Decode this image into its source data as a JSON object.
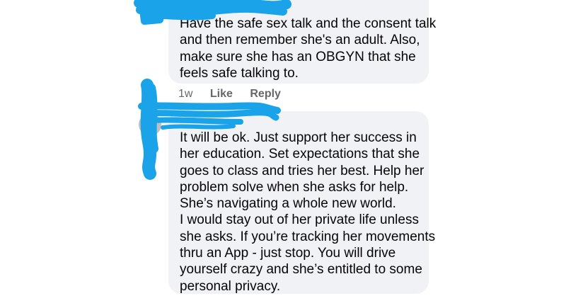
{
  "comments": [
    {
      "author": "...",
      "lines": [
        "Have the safe sex talk and the consent talk",
        "and then remember she's an adult. Also,",
        "make sure she has an OBGYN that she",
        "feels safe talking to."
      ],
      "time": "1w",
      "like_label": "Like",
      "reply_label": "Reply"
    },
    {
      "author": "...",
      "lines": [
        "It will be ok. Just support her success in",
        "her education. Set expectations that she",
        "goes to class and tries her best. Help her",
        "problem solve when she asks for help.",
        "She’s navigating a whole new world.",
        "I would stay out of her private life unless",
        "she asks. If you’re tracking her movements",
        "thru an App - just stop. You will drive",
        "yourself crazy and she’s entitled to some",
        "personal privacy."
      ]
    }
  ],
  "colors": {
    "bubble_bg": "#f0f2f5",
    "text": "#050505",
    "secondary_text": "#65676b",
    "redaction_marker": "#1aa3e8"
  }
}
